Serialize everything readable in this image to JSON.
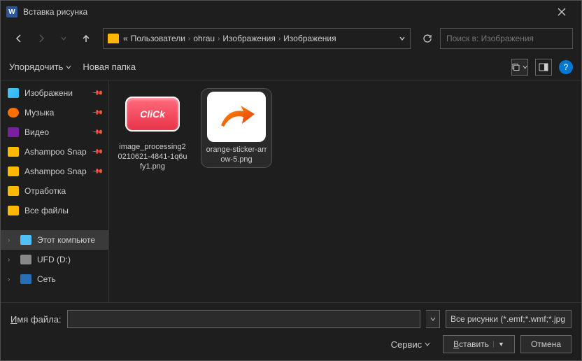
{
  "title": "Вставка рисунка",
  "titlebar_icon": "W",
  "breadcrumb": {
    "prefix": "«",
    "parts": [
      "Пользователи",
      "ohrau",
      "Изображения",
      "Изображения"
    ]
  },
  "search": {
    "placeholder": "Поиск в: Изображения"
  },
  "toolbar": {
    "organize": "Упорядочить",
    "new_folder": "Новая папка",
    "help": "?"
  },
  "sidebar": {
    "items": [
      {
        "icon": "images",
        "label": "Изображени",
        "pin": true
      },
      {
        "icon": "music",
        "label": "Музыка",
        "pin": true
      },
      {
        "icon": "video",
        "label": "Видео",
        "pin": true
      },
      {
        "icon": "folder",
        "label": "Ashampoo Snap",
        "pin": true
      },
      {
        "icon": "folder",
        "label": "Ashampoo Snap",
        "pin": true
      },
      {
        "icon": "folder",
        "label": "Отработка"
      },
      {
        "icon": "folder",
        "label": "Все файлы"
      }
    ],
    "bottom": [
      {
        "icon": "pc",
        "label": "Этот компьюте",
        "expand": true,
        "selected": true
      },
      {
        "icon": "drive",
        "label": "UFD (D:)",
        "expand": true
      },
      {
        "icon": "network",
        "label": "Сеть",
        "expand": true
      }
    ]
  },
  "files": [
    {
      "thumb": "click",
      "name": "image_processing20210621-4841-1q6ufy1.png",
      "selected": false
    },
    {
      "thumb": "arrow",
      "name": "orange-sticker-arrow-5.png",
      "selected": true
    }
  ],
  "footer": {
    "filename_label": "Имя файла:",
    "filename_value": "",
    "filter_label": "Все рисунки (*.emf;*.wmf;*.jpg",
    "service": "Сервис",
    "insert": "Вставить",
    "cancel": "Отмена"
  }
}
